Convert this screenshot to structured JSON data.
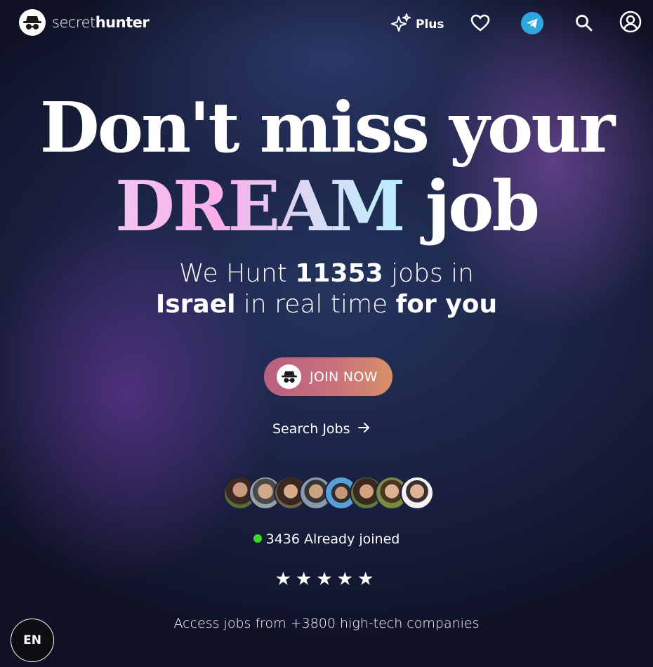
{
  "brand": {
    "name_light": "secret",
    "name_bold": "hunter",
    "logo_icon": "incognito-icon"
  },
  "nav": {
    "plus_label": "Plus",
    "plus_icon": "sparkles-icon",
    "favorites_icon": "heart-icon",
    "telegram_icon": "telegram-icon",
    "search_icon": "search-icon",
    "account_icon": "user-circle-icon"
  },
  "hero": {
    "line1": "Don't miss your",
    "line2_accent": "DREAM",
    "line2_rest": "job",
    "sub_we_hunt": "We Hunt",
    "sub_count": "11353",
    "sub_jobs_in": "jobs in",
    "sub_country": "Israel",
    "sub_realtime": "in real time",
    "sub_for_you": "for you"
  },
  "cta": {
    "join_label": "JOIN NOW",
    "search_label": "Search Jobs",
    "search_icon": "arrow-right-icon"
  },
  "social_proof": {
    "joined_count": "3436",
    "joined_label": "Already joined",
    "rating_stars": 5,
    "avatar_count": 8
  },
  "footer": {
    "companies_text": "Access jobs from +3800 high-tech companies",
    "lang": "EN"
  },
  "colors": {
    "join_gradient_start": "#b8607e",
    "join_gradient_end": "#d89068",
    "online_dot": "#3ddc24",
    "telegram": "#2ea6e0"
  }
}
